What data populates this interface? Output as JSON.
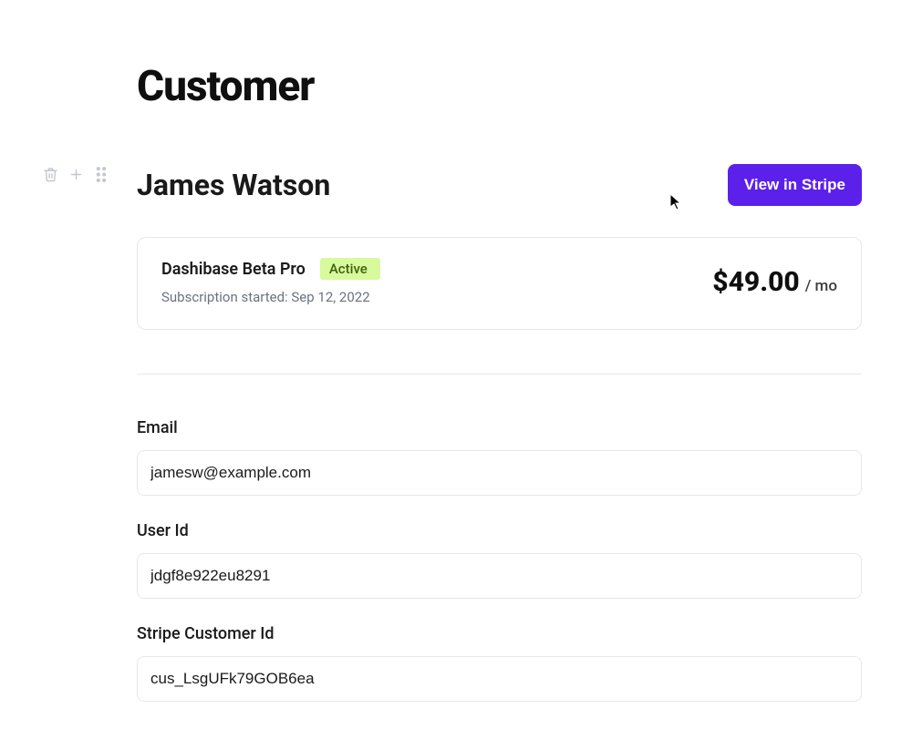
{
  "page": {
    "title": "Customer"
  },
  "customer": {
    "name": "James Watson"
  },
  "actions": {
    "view_in_stripe": "View in Stripe"
  },
  "subscription": {
    "plan_name": "Dashibase Beta Pro",
    "status": "Active",
    "started_text": "Subscription started: Sep 12, 2022",
    "price_amount": "$49.00",
    "price_period": "/ mo"
  },
  "fields": {
    "email": {
      "label": "Email",
      "value": "jamesw@example.com"
    },
    "user_id": {
      "label": "User Id",
      "value": "jdgf8e922eu8291"
    },
    "stripe_customer_id": {
      "label": "Stripe Customer Id",
      "value": "cus_LsgUFk79GOB6ea"
    }
  }
}
